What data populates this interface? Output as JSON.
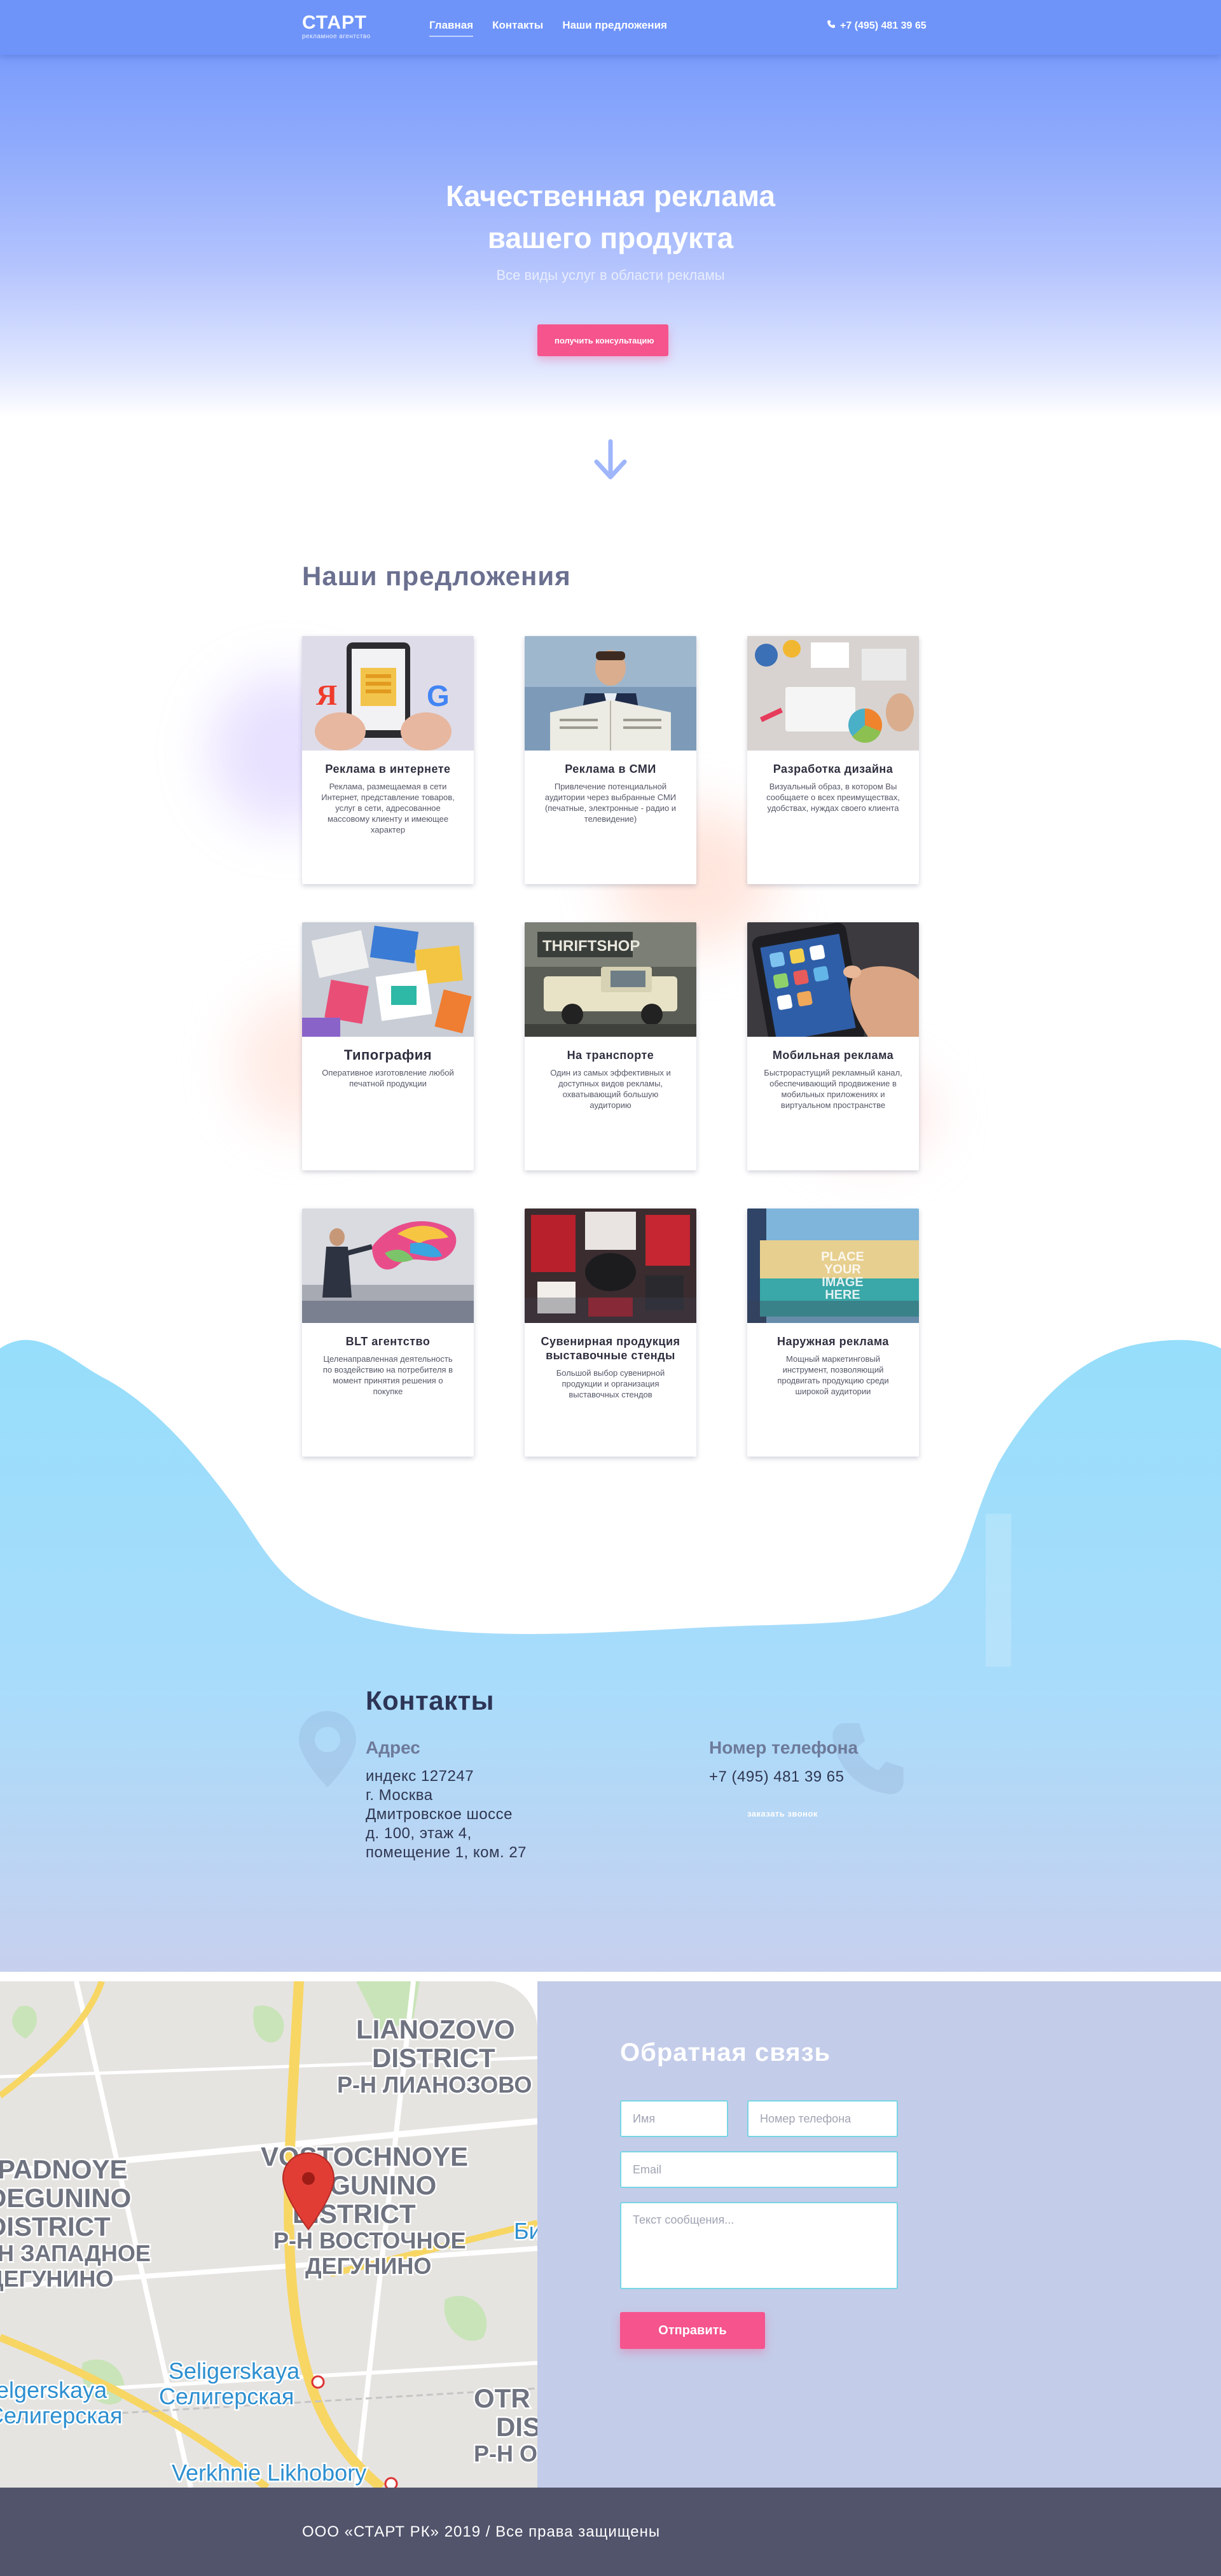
{
  "colors": {
    "accent": "#6e94fa",
    "button": "#f5548d",
    "wave": "#9adefb",
    "footer": "#52546c",
    "feedback_bg": "#c3cce9"
  },
  "header": {
    "logo_title": "СТАРТ",
    "logo_subtitle": "рекламное агентство",
    "nav": [
      {
        "label": "Главная",
        "active": true
      },
      {
        "label": "Контакты",
        "active": false
      },
      {
        "label": "Наши предложения",
        "active": false
      }
    ],
    "phone": "+7 (495) 481 39 65",
    "phone_icon": "phone-icon"
  },
  "hero": {
    "title_line1": "Качественная реклама",
    "title_line2": "вашего продукта",
    "subtitle": "Все виды услуг в области рекламы",
    "button": "получить консультацию",
    "arrow_icon": "arrow-down-icon"
  },
  "offers": {
    "title": "Наши предложения",
    "items": [
      {
        "title": "Реклама в интернете",
        "text": "Реклама, размещаемая в сети Интернет, представление товаров, услуг в сети, адресованное массовому клиенту и имеющее характер"
      },
      {
        "title": "Реклама в СМИ",
        "text": "Привлечение потенциальной аудитории через выбранные СМИ (печатные, электронные - радио и телевидение)"
      },
      {
        "title": "Разработка дизайна",
        "text": "Визуальный образ, в котором Вы сообщаете о всех преимуществах, удобствах, нуждах своего клиента"
      },
      {
        "title": "Типография",
        "text": "Оперативное изготовление любой печатной продукции"
      },
      {
        "title": "На транспорте",
        "text": "Один из самых эффективных и доступных видов рекламы, охватывающий большую аудиторию"
      },
      {
        "title": "Мобильная реклама",
        "text": "Быстрорастущий рекламный канал, обеспечивающий продвижение в мобильных приложениях и виртуальном пространстве"
      },
      {
        "title": "BLT агентство",
        "text": "Целенаправленная деятельность по воздействию на потребителя в момент принятия решения о покупке"
      },
      {
        "title": "Сувенирная продукция выставочные стенды",
        "text": "Большой выбор сувенирной продукции и организация выставочных стендов"
      },
      {
        "title": "Наружная реклама",
        "text": "Мощный маркетинговый инструмент, позволяющий продвигать продукцию среди широкой аудитории"
      }
    ],
    "image_texts": {
      "search_letter_ya": "Я",
      "search_letter_g": "G",
      "shop_sign": "THRIFTSHOP",
      "billboard": [
        "PLACE",
        "YOUR",
        "IMAGE",
        "HERE"
      ]
    }
  },
  "contacts": {
    "title": "Контакты",
    "address_label": "Адрес",
    "address_lines": [
      "индекс 127247",
      "г. Москва",
      "Дмитровское шоссе",
      "д. 100, этаж 4,",
      "помещение 1, ком. 27"
    ],
    "phone_label": "Номер телефона",
    "phone_value": "+7 (495) 481 39 65",
    "callback": "заказать звонок"
  },
  "map": {
    "labels": [
      "LIANOZOVO",
      "DISTRICT",
      "Р-Н ЛИАНОЗОВО",
      "ZAPADNOYE",
      "DEGUNINO",
      "DISTRICT",
      "Р-Н ЗАПАДНОЕ",
      "ДЕГУНИНО",
      "VOSTOCHNOYE",
      "DEGUNINO",
      "DISTRICT",
      "Р-Н ВОСТОЧНОЕ",
      "ДЕГУНИНО",
      "Seligerskaya",
      "Селигерская",
      "Selgerskaya",
      "Селигерская",
      "Verkhnie Likhobory",
      "OTR",
      "DIS",
      "Р-Н О",
      "Би"
    ]
  },
  "feedback": {
    "title": "Обратная связь",
    "name_placeholder": "Имя",
    "phone_placeholder": "Номер телефона",
    "email_placeholder": "Email",
    "message_placeholder": "Текст сообщения...",
    "submit": "Отправить"
  },
  "footer": {
    "copyright": "ООО «СТАРТ РК» 2019 / Все права защищены"
  }
}
